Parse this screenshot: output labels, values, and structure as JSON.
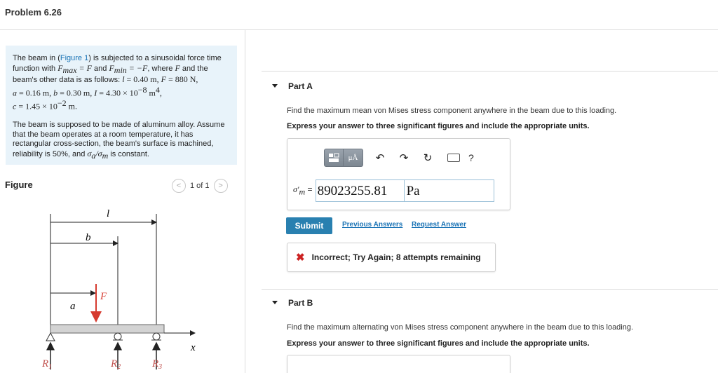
{
  "header": {
    "title": "Problem 6.26"
  },
  "problem": {
    "p1_a": "The beam in (",
    "p1_link": "Figure 1",
    "p1_b": ") is subjected to a sinusoidal force time function with ",
    "fmax": "F",
    "fmax_sub": "max",
    "eq_F": " = F",
    "and1": " and ",
    "fmin": "F",
    "fmin_sub": "min",
    "eq_negF": " = −F",
    "where": ", where ",
    "F": "F",
    "and_the": " and the beam's other data is as follows: ",
    "l_eq": "l",
    "l_val": " = 0.40 m, ",
    "F2": "F",
    "F_val": " = 880 N,",
    "a_eq": "a",
    "a_val": " = 0.16 m, ",
    "b_eq": "b",
    "b_val": " = 0.30 m, ",
    "I_eq": "I",
    "I_val": " = 4.30 × 10",
    "I_exp": "−8",
    "I_unit": " m",
    "I_unit_exp": "4",
    "I_end": ",",
    "c_eq": "c",
    "c_val": " = 1.45 × 10",
    "c_exp": "−2",
    "c_unit": " m.",
    "p2": "The beam is supposed to be made of aluminum alloy. Assume that the beam operates at a room temperature, it has rectangular cross-section, the beam's surface is machined, reliability is 50%, and ",
    "sig_a": "σ",
    "sig_a_sub": "a",
    "slash": "/",
    "sig_m": "σ",
    "sig_m_sub": "m",
    "p2_end": " is constant."
  },
  "figure": {
    "heading": "Figure",
    "pager": "1 of 1",
    "prev": "<",
    "next": ">",
    "labels": {
      "l": "l",
      "b": "b",
      "a": "a",
      "F": "F",
      "x": "x",
      "R1": "R",
      "R1s": "1",
      "R2": "R",
      "R2s": "2",
      "R3": "R",
      "R3s": "3"
    }
  },
  "partA": {
    "label": "Part A",
    "question": "Find the maximum mean von Mises stress component anywhere in the beam due to this loading.",
    "instruction": "Express your answer to three significant figures and include the appropriate units.",
    "toolbar": {
      "mu": "μÅ",
      "undo": "↶",
      "redo": "↷",
      "reset": "↻",
      "help": "?"
    },
    "answer_label": "σ′",
    "answer_label_sub": "m",
    "answer_eq": " =",
    "answer_value": "89023255.81",
    "answer_unit": "Pa",
    "submit": "Submit",
    "previous": "Previous Answers",
    "request": "Request Answer",
    "feedback_icon": "✖",
    "feedback": "Incorrect; Try Again; 8 attempts remaining"
  },
  "partB": {
    "label": "Part B",
    "question": "Find the maximum alternating von Mises stress component anywhere in the beam due to this loading.",
    "instruction": "Express your answer to three significant figures and include the appropriate units."
  },
  "colors": {
    "accent": "#2980b0",
    "link": "#1a73b5",
    "problem_bg": "#e8f3fa",
    "error": "#cc2222",
    "force_arrow": "#d63a2f"
  }
}
